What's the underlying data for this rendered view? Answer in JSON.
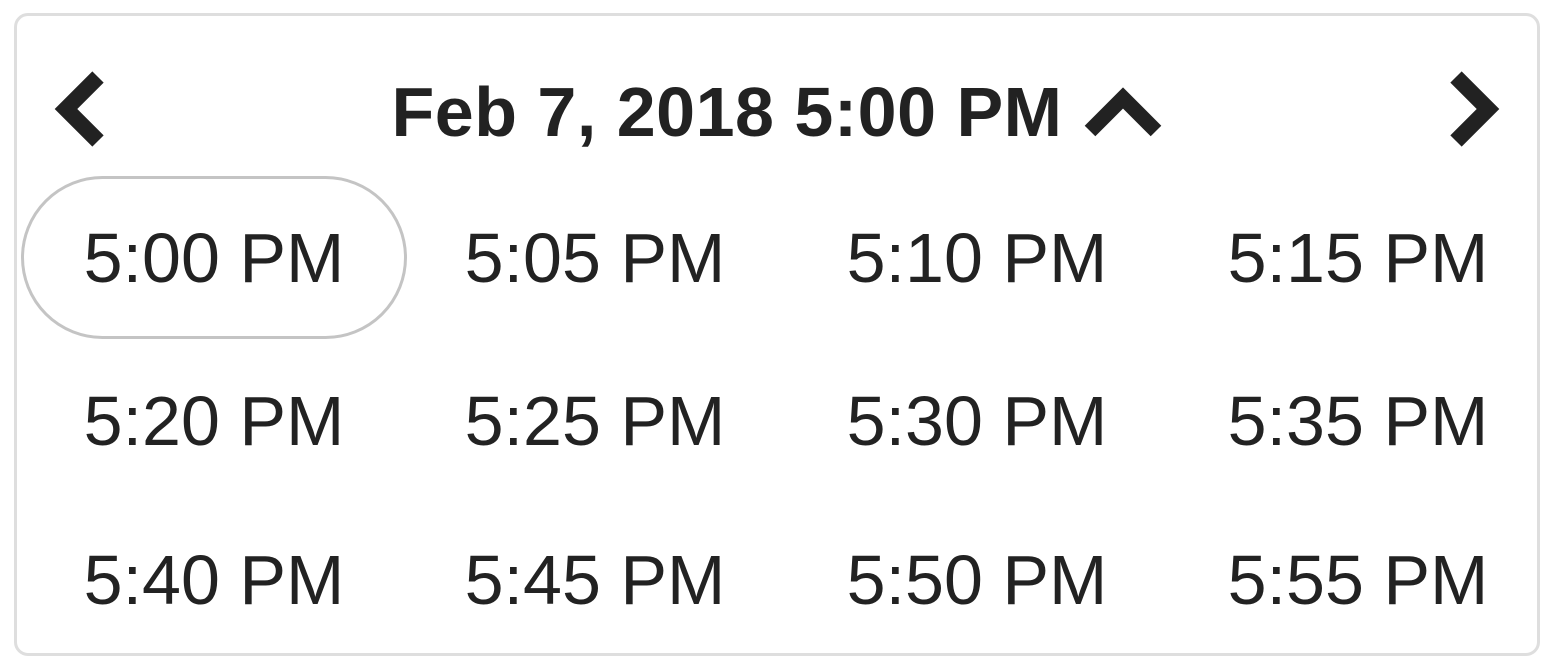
{
  "header": {
    "title": "Feb 7, 2018 5:00 PM",
    "prev_icon": "chevron-left-icon",
    "next_icon": "chevron-right-icon",
    "toggle_icon": "chevron-up-icon"
  },
  "times": [
    {
      "label": "5:00 PM",
      "selected": true
    },
    {
      "label": "5:05 PM",
      "selected": false
    },
    {
      "label": "5:10 PM",
      "selected": false
    },
    {
      "label": "5:15 PM",
      "selected": false
    },
    {
      "label": "5:20 PM",
      "selected": false
    },
    {
      "label": "5:25 PM",
      "selected": false
    },
    {
      "label": "5:30 PM",
      "selected": false
    },
    {
      "label": "5:35 PM",
      "selected": false
    },
    {
      "label": "5:40 PM",
      "selected": false
    },
    {
      "label": "5:45 PM",
      "selected": false
    },
    {
      "label": "5:50 PM",
      "selected": false
    },
    {
      "label": "5:55 PM",
      "selected": false
    }
  ],
  "colors": {
    "text": "#222222",
    "border": "#dedede",
    "selected_border": "#c4c4c4"
  }
}
